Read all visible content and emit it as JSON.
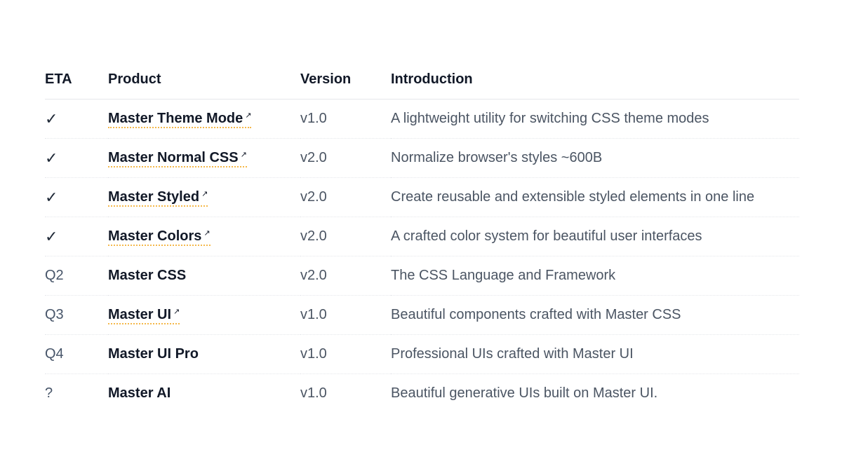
{
  "table": {
    "headers": {
      "eta": "ETA",
      "product": "Product",
      "version": "Version",
      "introduction": "Introduction"
    },
    "rows": [
      {
        "eta": "✓",
        "done": true,
        "product": "Master Theme Mode",
        "link": true,
        "version": "v1.0",
        "introduction": "A lightweight utility for switching CSS theme modes"
      },
      {
        "eta": "✓",
        "done": true,
        "product": "Master Normal CSS",
        "link": true,
        "version": "v2.0",
        "introduction": "Normalize browser's styles ~600B"
      },
      {
        "eta": "✓",
        "done": true,
        "product": "Master Styled",
        "link": true,
        "version": "v2.0",
        "introduction": "Create reusable and extensible styled elements in one line"
      },
      {
        "eta": "✓",
        "done": true,
        "product": "Master Colors",
        "link": true,
        "version": "v2.0",
        "introduction": "A crafted color system for beautiful user interfaces"
      },
      {
        "eta": "Q2",
        "done": false,
        "product": "Master CSS",
        "link": false,
        "version": "v2.0",
        "introduction": "The CSS Language and Framework"
      },
      {
        "eta": "Q3",
        "done": false,
        "product": "Master UI",
        "link": true,
        "version": "v1.0",
        "introduction": "Beautiful components crafted with Master CSS"
      },
      {
        "eta": "Q4",
        "done": false,
        "product": "Master UI Pro",
        "link": false,
        "version": "v1.0",
        "introduction": "Professional UIs crafted with Master UI"
      },
      {
        "eta": "?",
        "done": false,
        "product": "Master AI",
        "link": false,
        "version": "v1.0",
        "introduction": "Beautiful generative UIs built on Master UI."
      }
    ]
  },
  "icons": {
    "check": "check-icon",
    "external": "external-link-icon"
  },
  "colors": {
    "link_underline": "#f5b84a",
    "text_strong": "#111827",
    "text_muted": "#4b5563"
  }
}
